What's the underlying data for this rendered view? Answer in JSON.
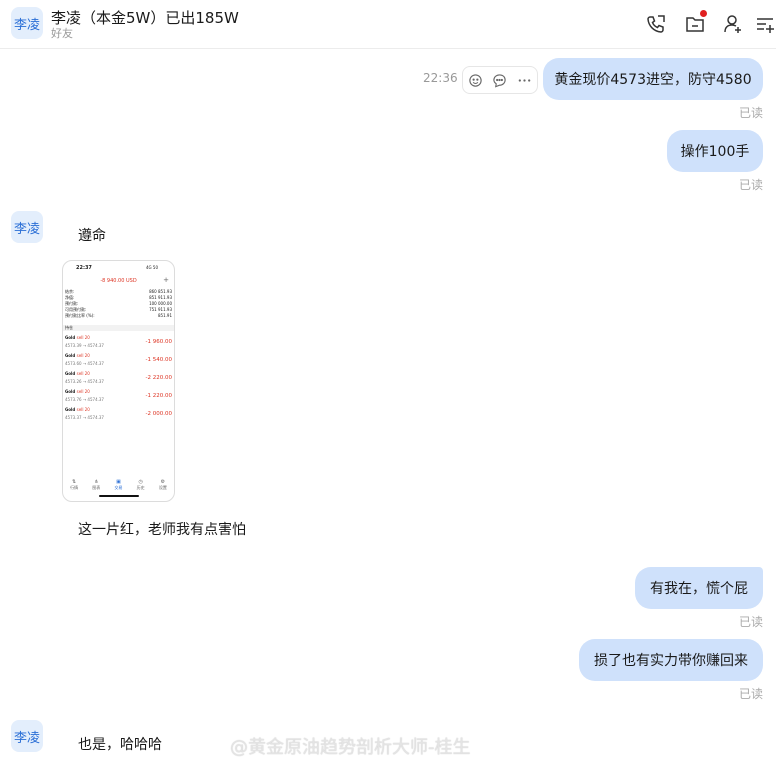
{
  "header": {
    "avatar_text": "李凌",
    "title": "李凌（本金5W）已出185W",
    "subtitle": "好友",
    "icons": [
      "phone-icon",
      "folder-icon",
      "add-contact-icon",
      "more-list-icon"
    ]
  },
  "messages": {
    "time": "22:36",
    "m1": {
      "text": "黄金现价4573进空，防守4580",
      "read": "已读"
    },
    "m2": {
      "text": "操作100手",
      "read": "已读"
    },
    "other1": {
      "avatar": "李凌",
      "text": "遵命"
    },
    "other2": {
      "text": "这一片红，老师我有点害怕"
    },
    "m3": {
      "text": "有我在，慌个屁",
      "read": "已读"
    },
    "m4": {
      "text": "损了也有实力带你赚回来",
      "read": "已读"
    },
    "other3": {
      "avatar": "李凌",
      "text": "也是，哈哈哈"
    }
  },
  "screenshot": {
    "time": "22:37",
    "signal": "4G 50",
    "balance_change": "-8 940.00 USD",
    "rows": [
      {
        "label": "结余:",
        "value": "860 851.93"
      },
      {
        "label": "净值:",
        "value": "851 911.93"
      },
      {
        "label": "预付款:",
        "value": "100 000.00"
      },
      {
        "label": "可用预付款:",
        "value": "751 911.93"
      },
      {
        "label": "预付款比率 (%):",
        "value": "851.91"
      }
    ],
    "section": "持仓",
    "trades": [
      {
        "symbol": "Gold",
        "side": "sell 20",
        "prices": "4573.39 → 4574.37",
        "pl": "-1 960.00"
      },
      {
        "symbol": "Gold",
        "side": "sell 20",
        "prices": "4573.60 → 4574.37",
        "pl": "-1 540.00"
      },
      {
        "symbol": "Gold",
        "side": "sell 20",
        "prices": "4573.26 → 4574.37",
        "pl": "-2 220.00"
      },
      {
        "symbol": "Gold",
        "side": "sell 20",
        "prices": "4573.76 → 4574.37",
        "pl": "-1 220.00"
      },
      {
        "symbol": "Gold",
        "side": "sell 20",
        "prices": "4573.37 → 4574.37",
        "pl": "-2 000.00"
      }
    ],
    "tabs": [
      "行情",
      "图表",
      "交易",
      "历史",
      "设置"
    ]
  },
  "watermark": "@黄金原油趋势剖析大师-桂生",
  "colors": {
    "bubble": "#cfe1fb",
    "accent": "#2b6fd6",
    "loss": "#dd3322"
  }
}
